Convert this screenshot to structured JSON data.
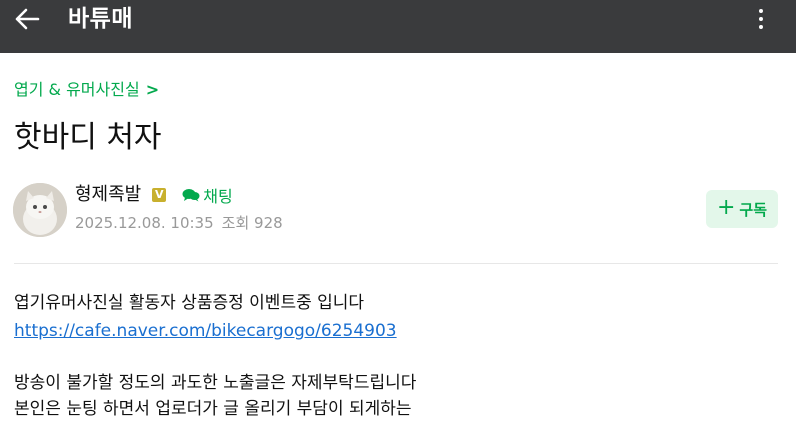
{
  "header": {
    "back_icon": "arrow-left-icon",
    "cafe_name": "바튜매",
    "more_icon": "more-vertical-icon",
    "background": "#3a3b3d"
  },
  "board": {
    "label": "엽기 & 유머사진실",
    "chevron": ">",
    "color": "#03a94d"
  },
  "post": {
    "title": "핫바디 처자",
    "author": {
      "name": "형제족발",
      "level_badge": "V",
      "chat_label": "채팅",
      "chat_icon": "chat-bubbles-icon"
    },
    "date": "2025.12.08. 10:35",
    "views_text": "조회 928",
    "subscribe_label": "구독",
    "subscribe_icon": "plus-icon",
    "body": {
      "line1": "엽기유머사진실 활동자 상품증정 이벤트중 입니다",
      "link": "https://cafe.naver.com/bikecargogo/6254903",
      "line3": "방송이 불가할 정도의 과도한 노출글은 자제부탁드립니다",
      "line4": "본인은 눈팅 하면서 업로더가 글 올리기 부담이 되게하는"
    }
  }
}
